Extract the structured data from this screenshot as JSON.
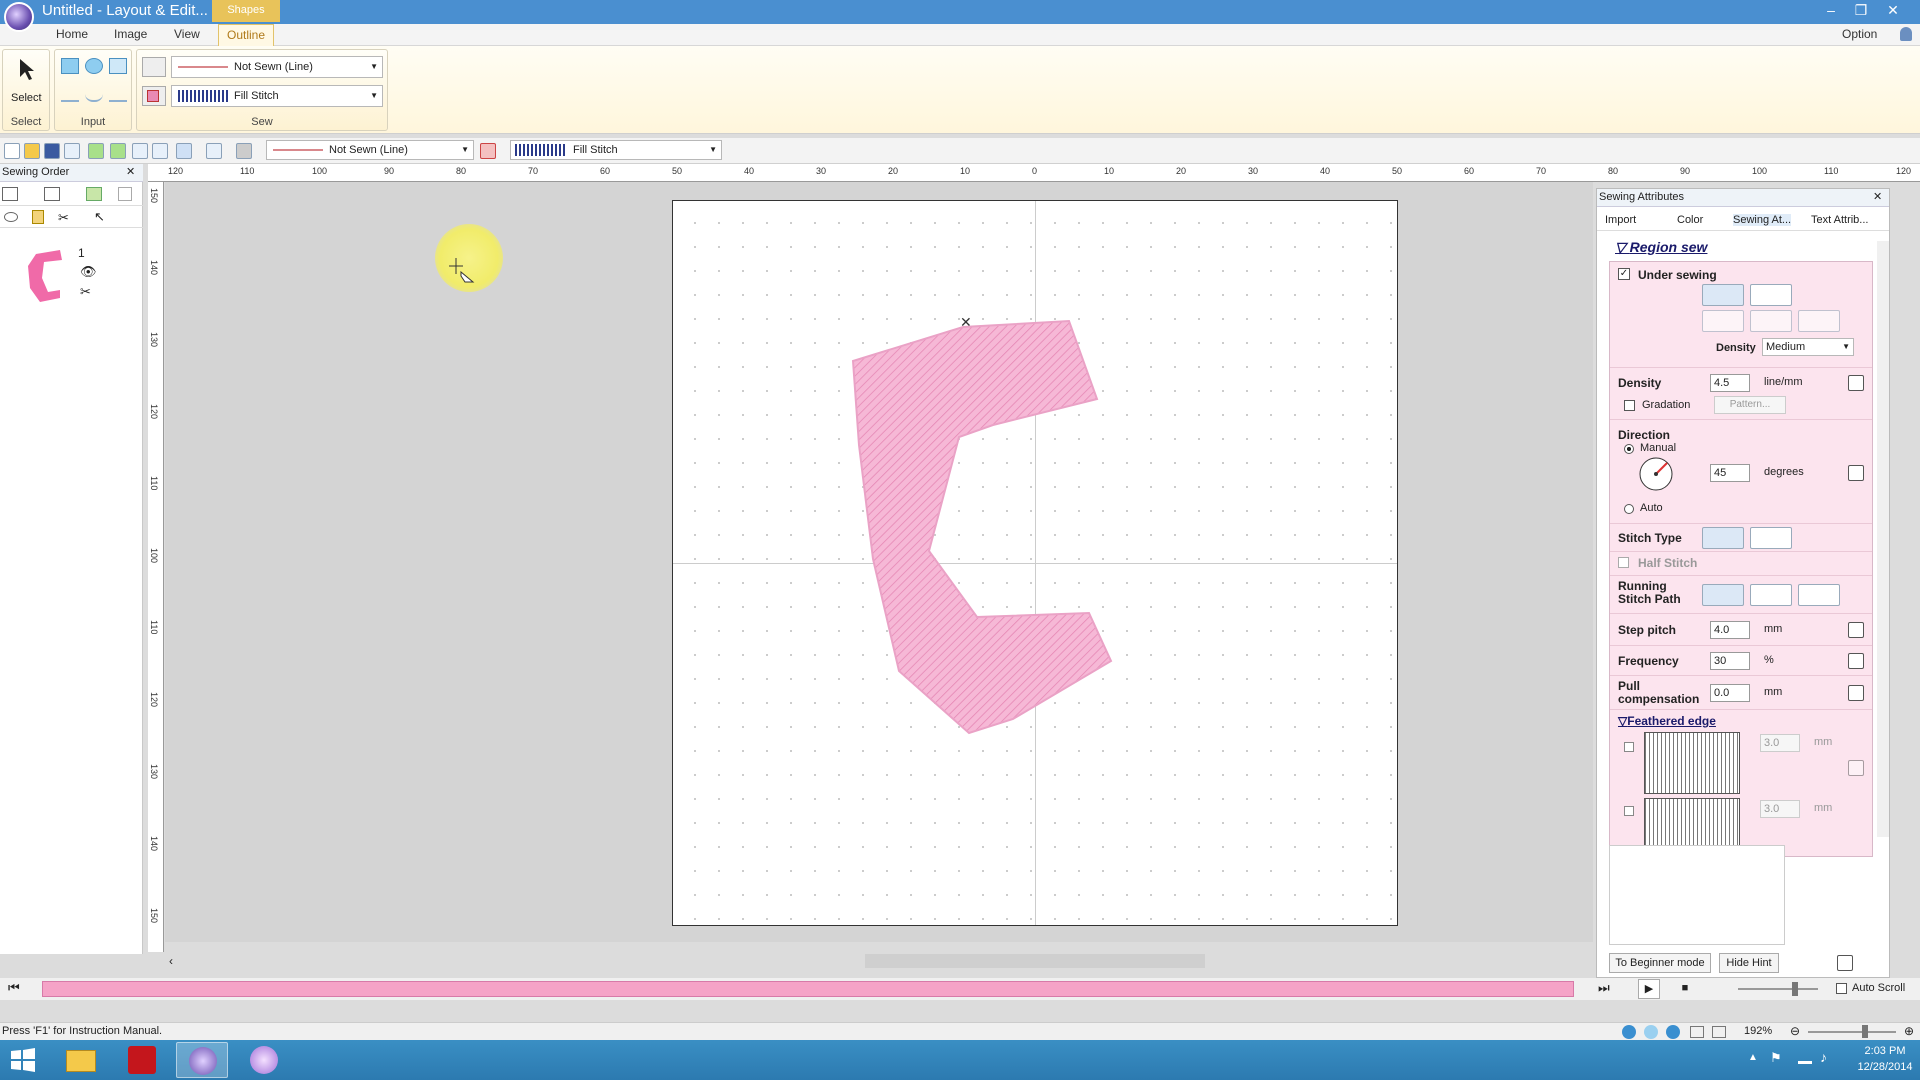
{
  "window": {
    "title": "Untitled - Layout & Edit...",
    "context_tab": "Shapes"
  },
  "menu_tabs": [
    "Home",
    "Image",
    "View",
    "Outline"
  ],
  "option_label": "Option",
  "ribbon": {
    "groups": {
      "select": "Select",
      "input": "Input",
      "sew": "Sew"
    },
    "select_button": "Select",
    "line_sew": "Not Sewn (Line)",
    "region_sew": "Fill Stitch"
  },
  "quickbar": {
    "line_sew": "Not Sewn (Line)",
    "region_sew": "Fill Stitch"
  },
  "ruler": {
    "h_ticks": [
      "120",
      "110",
      "100",
      "90",
      "80",
      "70",
      "60",
      "50",
      "40",
      "30",
      "20",
      "10",
      "0",
      "10",
      "20",
      "30",
      "40",
      "50",
      "60",
      "70",
      "80",
      "90",
      "100",
      "110",
      "120"
    ],
    "v_ticks": [
      "150",
      "140",
      "130",
      "120",
      "110",
      "100",
      "110",
      "120",
      "130",
      "140",
      "150"
    ]
  },
  "sewing_order": {
    "title": "Sewing Order",
    "item_number": "1"
  },
  "attributes": {
    "title": "Sewing Attributes",
    "tabs": [
      "Import",
      "Color",
      "Sewing At...",
      "Text Attrib..."
    ],
    "section": "Region sew",
    "under_sewing": "Under sewing",
    "density_label": "Density",
    "under_density_value": "Medium",
    "density": {
      "label": "Density",
      "value": "4.5",
      "unit": "line/mm"
    },
    "gradation": {
      "label": "Gradation",
      "button": "Pattern..."
    },
    "direction": {
      "label": "Direction",
      "manual": "Manual",
      "value": "45",
      "unit": "degrees",
      "auto": "Auto"
    },
    "stitch_type": "Stitch Type",
    "half_stitch": "Half Stitch",
    "running_path": "Running Stitch Path",
    "step_pitch": {
      "label": "Step pitch",
      "value": "4.0",
      "unit": "mm"
    },
    "frequency": {
      "label": "Frequency",
      "value": "30",
      "unit": "%"
    },
    "pull_comp": {
      "label": "Pull compensation",
      "value": "0.0",
      "unit": "mm"
    },
    "feathered": {
      "label": "Feathered edge",
      "v1": "3.0",
      "v2": "3.0",
      "unit": "mm"
    },
    "buttons": {
      "beginner": "To Beginner mode",
      "hint": "Hide Hint"
    }
  },
  "playback": {
    "auto_scroll": "Auto Scroll"
  },
  "status": {
    "text": "Press 'F1' for Instruction Manual.",
    "zoom": "192%"
  },
  "clock": {
    "time": "2:03 PM",
    "date": "12/28/2014"
  },
  "colors": {
    "title_bar": "#4a8fd0",
    "fill_pink": "#f2a3c8",
    "panel_pink": "#fce4ee",
    "timeline": "#f5a3c7"
  }
}
